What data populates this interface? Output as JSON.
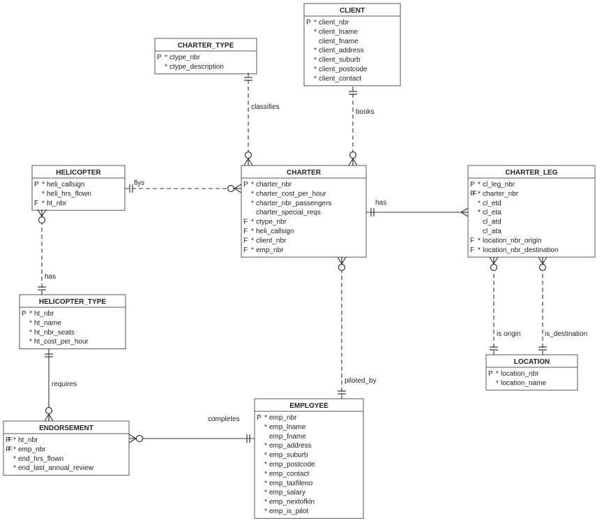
{
  "entities": [
    {
      "name": "CLIENT",
      "attributes": [
        {
          "key": "P",
          "req": true,
          "name": "client_nbr"
        },
        {
          "key": "",
          "req": true,
          "name": "client_lname"
        },
        {
          "key": "",
          "req": false,
          "name": "client_fname"
        },
        {
          "key": "",
          "req": true,
          "name": "client_address"
        },
        {
          "key": "",
          "req": true,
          "name": "client_suburb"
        },
        {
          "key": "",
          "req": true,
          "name": "client_postcode"
        },
        {
          "key": "",
          "req": true,
          "name": "client_contact"
        }
      ]
    },
    {
      "name": "CHARTER_TYPE",
      "attributes": [
        {
          "key": "P",
          "req": true,
          "name": "ctype_nbr"
        },
        {
          "key": "",
          "req": true,
          "name": "ctype_description"
        }
      ]
    },
    {
      "name": "HELICOPTER",
      "attributes": [
        {
          "key": "P",
          "req": true,
          "name": "heli_callsign"
        },
        {
          "key": "",
          "req": true,
          "name": "heli_hrs_flown"
        },
        {
          "key": "F",
          "req": true,
          "name": "ht_nbr"
        }
      ]
    },
    {
      "name": "CHARTER",
      "attributes": [
        {
          "key": "P",
          "req": true,
          "name": "charter_nbr"
        },
        {
          "key": "",
          "req": true,
          "name": "charter_cost_per_hour"
        },
        {
          "key": "",
          "req": true,
          "name": "charter_nbr_passengers"
        },
        {
          "key": "",
          "req": false,
          "name": "charter_special_reqs"
        },
        {
          "key": "F",
          "req": true,
          "name": "ctype_nbr"
        },
        {
          "key": "F",
          "req": true,
          "name": "heli_callsign"
        },
        {
          "key": "F",
          "req": true,
          "name": "client_nbr"
        },
        {
          "key": "F",
          "req": true,
          "name": "emp_nbr"
        }
      ]
    },
    {
      "name": "CHARTER_LEG",
      "attributes": [
        {
          "key": "P",
          "req": true,
          "name": "cl_leg_nbr"
        },
        {
          "key": "PF",
          "req": true,
          "name": "charter_nbr"
        },
        {
          "key": "",
          "req": true,
          "name": "cl_etd"
        },
        {
          "key": "",
          "req": true,
          "name": "cl_eta"
        },
        {
          "key": "",
          "req": false,
          "name": "cl_atd"
        },
        {
          "key": "",
          "req": false,
          "name": "cl_ata"
        },
        {
          "key": "F",
          "req": true,
          "name": "location_nbr_origin"
        },
        {
          "key": "F",
          "req": true,
          "name": "location_nbr_destination"
        }
      ]
    },
    {
      "name": "HELICOPTER_TYPE",
      "attributes": [
        {
          "key": "P",
          "req": true,
          "name": "ht_nbr"
        },
        {
          "key": "",
          "req": true,
          "name": "ht_name"
        },
        {
          "key": "",
          "req": true,
          "name": "ht_nbr_seats"
        },
        {
          "key": "",
          "req": true,
          "name": "ht_cost_per_hour"
        }
      ]
    },
    {
      "name": "LOCATION",
      "attributes": [
        {
          "key": "P",
          "req": true,
          "name": "location_nbr"
        },
        {
          "key": "",
          "req": true,
          "name": "location_name"
        }
      ]
    },
    {
      "name": "ENDORSEMENT",
      "attributes": [
        {
          "key": "PF",
          "req": true,
          "name": "ht_nbr"
        },
        {
          "key": "PF",
          "req": true,
          "name": "emp_nbr"
        },
        {
          "key": "",
          "req": true,
          "name": "end_hrs_flown"
        },
        {
          "key": "",
          "req": true,
          "name": "end_last_annual_review"
        }
      ]
    },
    {
      "name": "EMPLOYEE",
      "attributes": [
        {
          "key": "P",
          "req": true,
          "name": "emp_nbr"
        },
        {
          "key": "",
          "req": true,
          "name": "emp_lname"
        },
        {
          "key": "",
          "req": false,
          "name": "emp_fname"
        },
        {
          "key": "",
          "req": true,
          "name": "emp_address"
        },
        {
          "key": "",
          "req": true,
          "name": "emp_suburb"
        },
        {
          "key": "",
          "req": true,
          "name": "emp_postcode"
        },
        {
          "key": "",
          "req": true,
          "name": "emp_contact"
        },
        {
          "key": "",
          "req": true,
          "name": "emp_taxfileno"
        },
        {
          "key": "",
          "req": true,
          "name": "emp_salary"
        },
        {
          "key": "",
          "req": true,
          "name": "emp_nextofkin"
        },
        {
          "key": "",
          "req": true,
          "name": "emp_is_pilot"
        }
      ]
    }
  ],
  "relationships": [
    {
      "label": "classifies",
      "from": "CHARTER_TYPE",
      "to": "CHARTER",
      "from_card": "one",
      "to_card": "zero-many",
      "line": "dashed"
    },
    {
      "label": "books",
      "from": "CLIENT",
      "to": "CHARTER",
      "from_card": "one",
      "to_card": "zero-many",
      "line": "dashed"
    },
    {
      "label": "flys",
      "from": "HELICOPTER",
      "to": "CHARTER",
      "from_card": "one",
      "to_card": "zero-many",
      "line": "dashed"
    },
    {
      "label": "has",
      "from": "CHARTER",
      "to": "CHARTER_LEG",
      "from_card": "one",
      "to_card": "many",
      "line": "solid"
    },
    {
      "label": "has",
      "from": "HELICOPTER_TYPE",
      "to": "HELICOPTER",
      "from_card": "one",
      "to_card": "zero-many",
      "line": "dashed"
    },
    {
      "label": "piloted_by",
      "from": "EMPLOYEE",
      "to": "CHARTER",
      "from_card": "one",
      "to_card": "zero-many",
      "line": "dashed"
    },
    {
      "label": "is origin",
      "from": "LOCATION",
      "to": "CHARTER_LEG",
      "from_card": "one",
      "to_card": "zero-many",
      "line": "dashed"
    },
    {
      "label": "is_destination",
      "from": "LOCATION",
      "to": "CHARTER_LEG",
      "from_card": "one",
      "to_card": "zero-many",
      "line": "dashed"
    },
    {
      "label": "requires",
      "from": "HELICOPTER_TYPE",
      "to": "ENDORSEMENT",
      "from_card": "one",
      "to_card": "zero-many",
      "line": "solid"
    },
    {
      "label": "completes",
      "from": "EMPLOYEE",
      "to": "ENDORSEMENT",
      "from_card": "one",
      "to_card": "zero-many",
      "line": "solid"
    }
  ],
  "colors": {
    "line": "#333333",
    "box_border": "#555555",
    "text": "#222222"
  }
}
